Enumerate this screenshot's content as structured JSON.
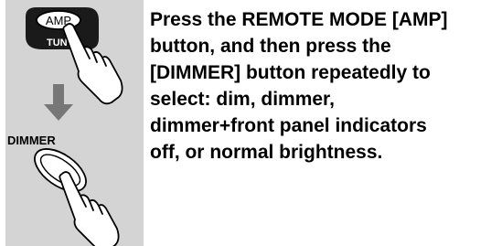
{
  "illustration": {
    "amp_button_label": "AMP",
    "tuner_button_label_partial": "TUN",
    "dimmer_button_label": "DIMMER",
    "hand_icon": "pointing-hand-icon",
    "arrow_icon": "down-arrow-icon",
    "panel_color": "#d4d4d4",
    "arrow_color": "#777777"
  },
  "instruction": {
    "lines": [
      "Press the REMOTE MODE [AMP]",
      "button, and then press the",
      "[DIMMER] button repeatedly to",
      "select: dim, dimmer,",
      "dimmer+front panel indicators",
      "off, or normal brightness."
    ]
  }
}
